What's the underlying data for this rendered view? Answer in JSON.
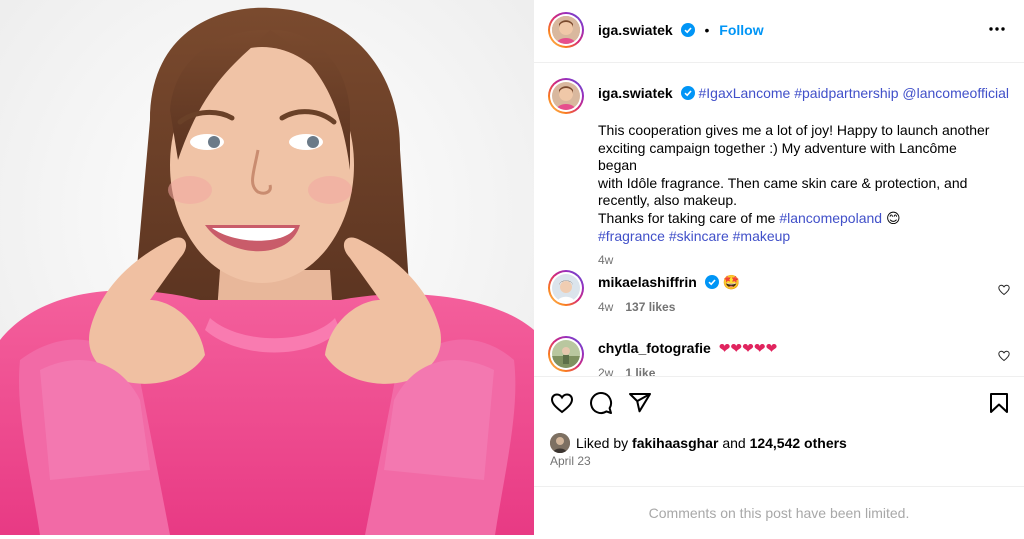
{
  "post": {
    "author": "iga.swiatek",
    "follow_label": "Follow",
    "dot": "•",
    "more_icon": "more-horizontal-icon"
  },
  "caption": {
    "author": "iga.swiatek",
    "tags_line": "#IgaxLancome #paidpartnership @lancomeofficial",
    "text_lines": [
      "This cooperation gives me a lot of joy! Happy to launch another",
      "exciting campaign together :) My adventure with Lancôme began",
      "with Idôle fragrance. Then came skin care & protection, and",
      "recently, also makeup."
    ],
    "thanks_text": "Thanks for taking care of me ",
    "thanks_tag": "#lancomepoland",
    "thanks_emoji": "😊",
    "hashtags_line": "#fragrance #skincare #makeup",
    "time": "4w"
  },
  "comments": [
    {
      "user": "mikaelashiffrin",
      "text": "🤩",
      "time": "4w",
      "likes": "137 likes"
    },
    {
      "user": "chytla_fotografie",
      "text": "❤❤❤❤❤",
      "time": "2w",
      "likes": "1 like"
    }
  ],
  "actions": {
    "like_icon": "heart-icon",
    "comment_icon": "comment-icon",
    "share_icon": "share-icon",
    "save_icon": "bookmark-icon"
  },
  "likes": {
    "prefix": "Liked by",
    "user": "fakihaasghar",
    "middle": "and",
    "count": "124,542 others"
  },
  "date": "April 23",
  "comments_limited": "Comments on this post have been limited.",
  "colors": {
    "link_blue": "#0095f6",
    "hashtag": "#4150c9",
    "sweater_pink": "#f0488f",
    "muted": "#737373"
  }
}
